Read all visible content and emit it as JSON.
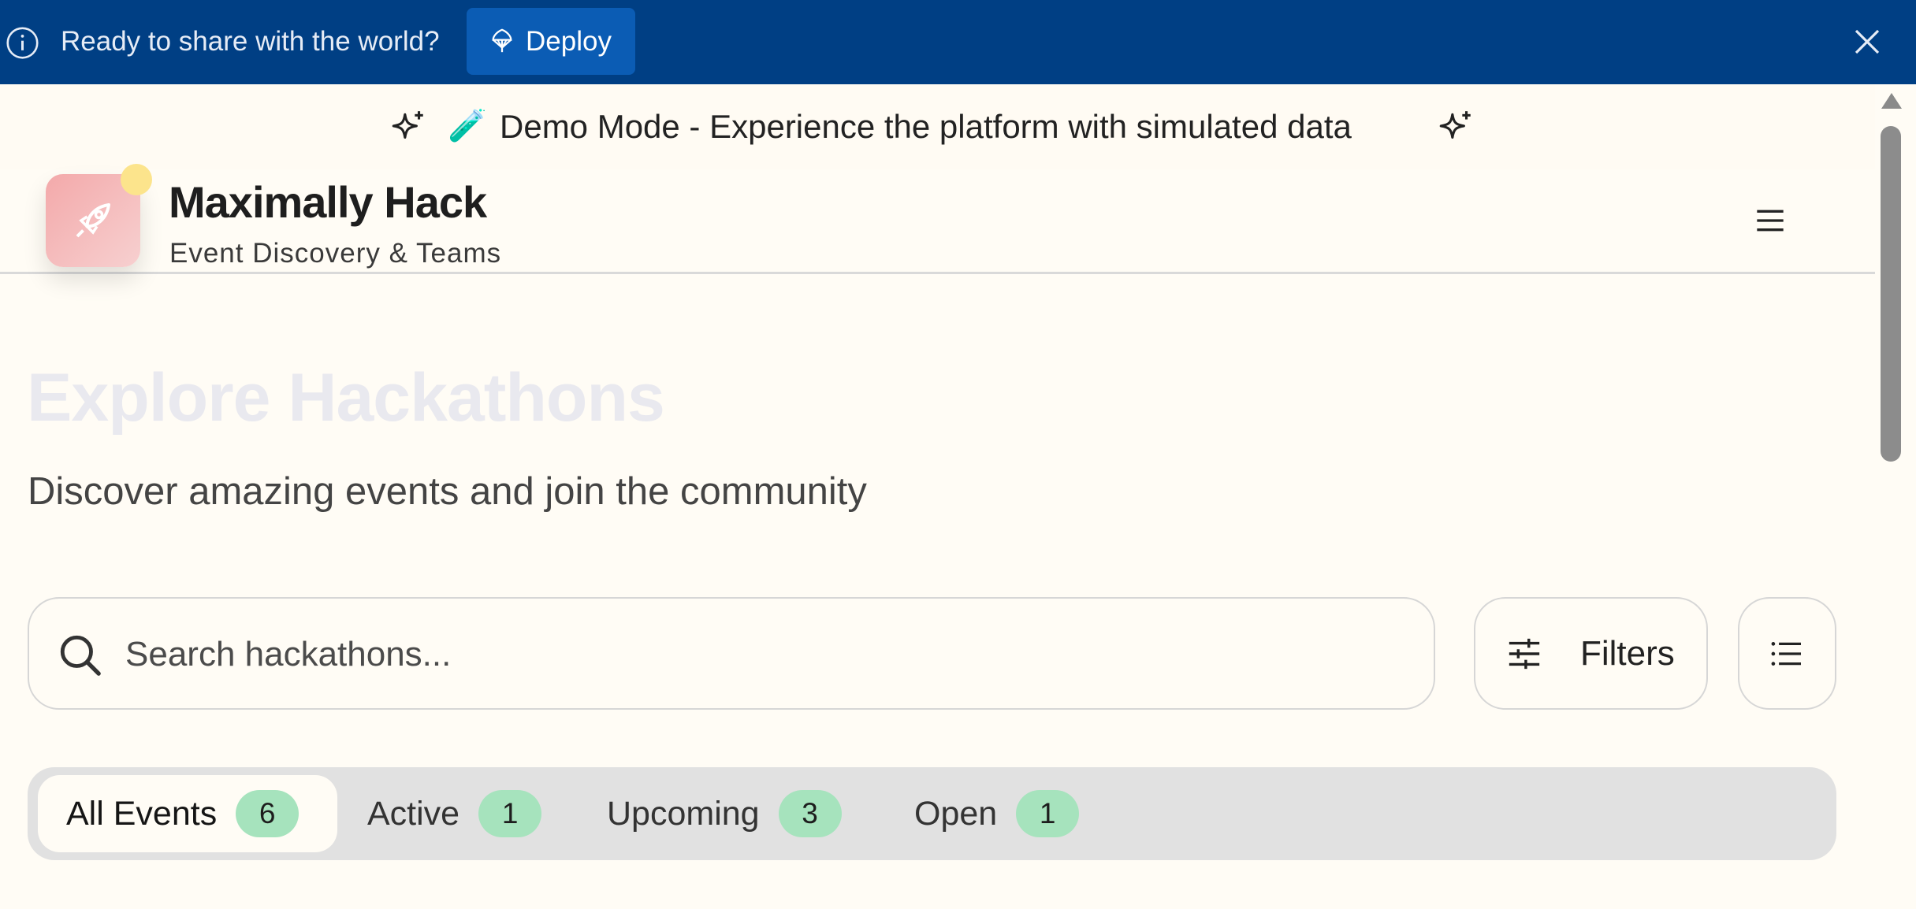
{
  "deploy_banner": {
    "message": "Ready to share with the world?",
    "deploy_label": "Deploy"
  },
  "demo_strip": {
    "text": "Demo Mode - Experience the platform with simulated data",
    "emoji": "🧪"
  },
  "header": {
    "title": "Maximally Hack",
    "subtitle": "Event Discovery & Teams"
  },
  "hero": {
    "title": "Explore Hackathons",
    "subtitle": "Discover amazing events and join the community"
  },
  "search": {
    "placeholder": "Search hackathons..."
  },
  "filters": {
    "label": "Filters"
  },
  "tabs": [
    {
      "label": "All Events",
      "count": "6"
    },
    {
      "label": "Active",
      "count": "1"
    },
    {
      "label": "Upcoming",
      "count": "3"
    },
    {
      "label": "Open",
      "count": "1"
    }
  ],
  "colors": {
    "banner_bg": "#003f84",
    "deploy_button": "#0b5cb4",
    "page_bg": "#fffcf5",
    "badge_bg": "#a6e3bd",
    "logo_gradient_start": "#f3a9aa",
    "logo_dot": "#fce48c"
  },
  "icons": {
    "info": "info-icon",
    "deploy": "rocket-launch-icon",
    "close": "close-icon",
    "sparkle": "sparkle-icon",
    "brand": "rocket-icon",
    "menu": "hamburger-menu-icon",
    "search": "search-icon",
    "filters": "sliders-icon",
    "list": "list-view-icon"
  }
}
